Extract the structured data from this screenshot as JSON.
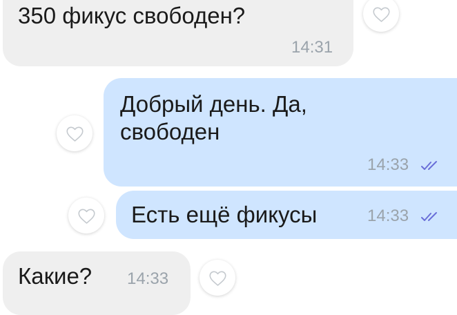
{
  "messages": [
    {
      "direction": "incoming",
      "text": "350 фикус свободен?",
      "time": "14:31"
    },
    {
      "direction": "outgoing",
      "text": "Добрый день. Да,\nсвободен",
      "time": "14:33",
      "status": "read"
    },
    {
      "direction": "outgoing",
      "text": "Есть ещё фикусы",
      "time": "14:33",
      "status": "read"
    },
    {
      "direction": "incoming",
      "text": "Какие?",
      "time": "14:33"
    }
  ],
  "icons": {
    "like": "heart-outline-icon",
    "read_receipt": "double-check-icon"
  },
  "colors": {
    "incoming_bubble": "#efefef",
    "outgoing_bubble": "#cfe5ff",
    "time_text": "#9aa3ab",
    "read_ticks": "#6a6fd8"
  }
}
